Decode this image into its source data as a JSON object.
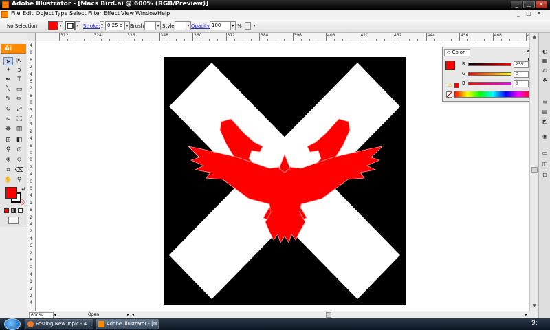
{
  "window": {
    "title": "Adobe Illustrator - [Macs Bird.ai @ 600% (RGB/Preview)]",
    "controls": [
      "_",
      "□",
      "✕"
    ]
  },
  "menu": {
    "items": [
      "File",
      "Edit",
      "Object",
      "Type",
      "Select",
      "Filter",
      "Effect",
      "View",
      "Window",
      "Help"
    ],
    "doc_controls": [
      "_",
      "□",
      "✕"
    ]
  },
  "control_bar": {
    "selection": "No Selection",
    "stroke_label": "Stroke:",
    "stroke_value": "0.25 p",
    "brush_label": "Brush:",
    "style_label": "Style:",
    "opacity_label": "Opacity:",
    "opacity_value": "100",
    "opacity_unit": "%",
    "fill_color": "#ff0000"
  },
  "ruler": {
    "h_labels": [
      "312",
      "324",
      "336",
      "348",
      "360",
      "372",
      "384",
      "396",
      "408",
      "420",
      "432",
      "444",
      "456",
      "468",
      "49"
    ],
    "v_labels": [
      "4",
      "0",
      "8",
      "2",
      "4",
      "6",
      "2",
      "8",
      "0",
      "3",
      "2",
      "4",
      "2",
      "4",
      "8",
      "0",
      "8",
      "2",
      "4",
      "6",
      "0",
      "4",
      "1",
      "8",
      "2",
      "4",
      "2",
      "4",
      "6",
      "2",
      "8",
      "0",
      "4",
      "1",
      "2",
      "2",
      "4"
    ]
  },
  "toolbox": {
    "logo": "Ai",
    "fill_color": "#ff0000",
    "stroke_color": "#ffffff"
  },
  "artwork": {
    "background": "#000000",
    "cross_color": "#ffffff",
    "bird_color": "#ff0000"
  },
  "color_panel": {
    "tab": "Color",
    "channels": [
      {
        "label": "R",
        "value": "255"
      },
      {
        "label": "G",
        "value": "0"
      },
      {
        "label": "B",
        "value": "0"
      }
    ],
    "current": "#ff0000"
  },
  "status": {
    "zoom": "600%",
    "state": "Open"
  },
  "taskbar": {
    "items": [
      {
        "label": "Posting New Topic - 4...",
        "icon": "browser-icon"
      },
      {
        "label": "Adobe Illustrator - [M...",
        "icon": "illustrator-icon"
      }
    ],
    "clock": "9:"
  }
}
